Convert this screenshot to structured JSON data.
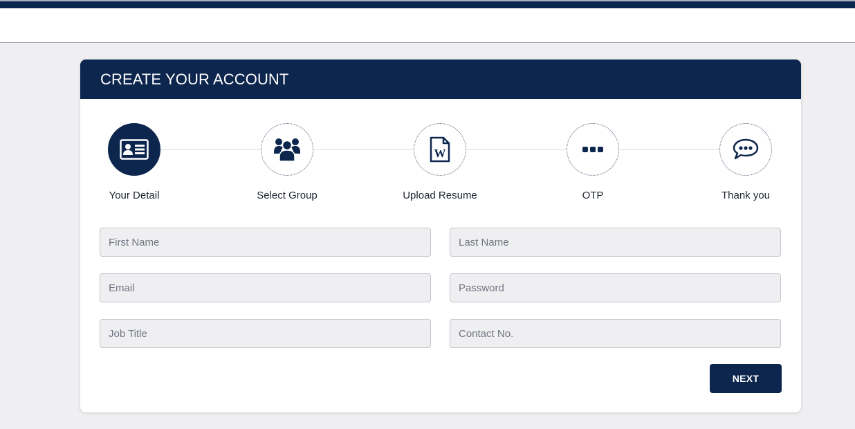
{
  "card": {
    "title": "CREATE YOUR ACCOUNT"
  },
  "steps": [
    {
      "label": "Your Detail",
      "icon": "id-card-icon",
      "active": true
    },
    {
      "label": "Select Group",
      "icon": "users-group-icon",
      "active": false
    },
    {
      "label": "Upload Resume",
      "icon": "word-document-icon",
      "active": false
    },
    {
      "label": "OTP",
      "icon": "ellipsis-icon",
      "active": false
    },
    {
      "label": "Thank you",
      "icon": "chat-bubble-icon",
      "active": false
    }
  ],
  "form": {
    "first_name": {
      "placeholder": "First Name",
      "value": ""
    },
    "last_name": {
      "placeholder": "Last Name",
      "value": ""
    },
    "email": {
      "placeholder": "Email",
      "value": ""
    },
    "password": {
      "placeholder": "Password",
      "value": ""
    },
    "job_title": {
      "placeholder": "Job Title",
      "value": ""
    },
    "contact_no": {
      "placeholder": "Contact No.",
      "value": ""
    }
  },
  "buttons": {
    "next_label": "NEXT"
  },
  "colors": {
    "brand_navy": "#0d264d",
    "page_bg": "#efeff1",
    "field_bg": "#efeff1"
  }
}
